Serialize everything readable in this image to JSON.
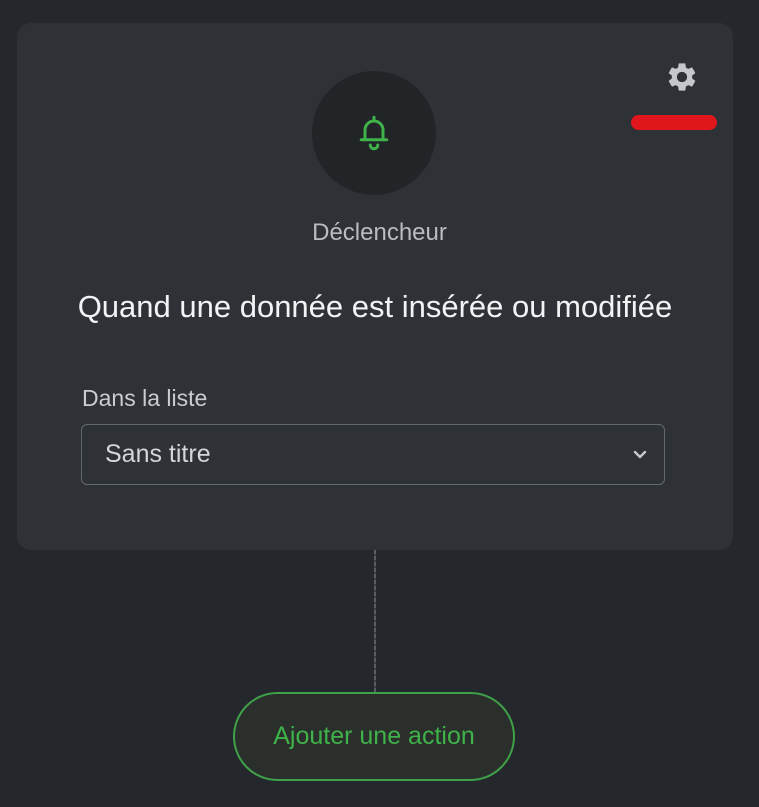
{
  "node": {
    "icon": "bell-icon",
    "trigger_label": "Déclencheur",
    "headline": "Quand une donnée est insérée ou modifiée",
    "settings_icon": "gear-icon",
    "list_field": {
      "label": "Dans la liste",
      "value": "Sans titre",
      "chevron_icon": "chevron-down-icon"
    }
  },
  "add_action": {
    "label": "Ajouter une action"
  },
  "colors": {
    "background": "#24272b",
    "card": "#2e3136",
    "accent_green": "#3fb24a",
    "highlight_red": "#e0161c"
  }
}
